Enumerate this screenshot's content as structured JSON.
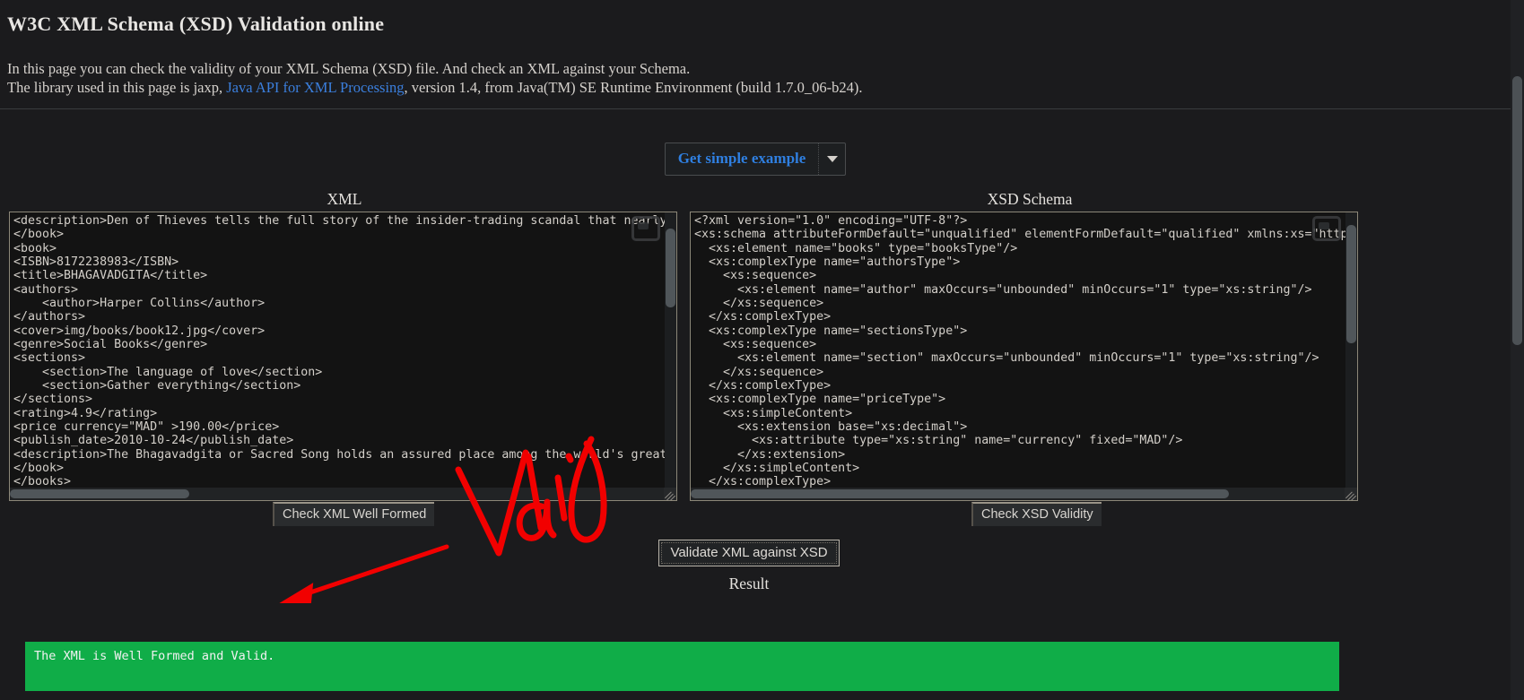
{
  "page": {
    "title": "W3C XML Schema (XSD) Validation online",
    "intro_line1": "In this page you can check the validity of your XML Schema (XSD) file. And check an XML against your Schema.",
    "intro_line2_before": "The library used in this page is jaxp, ",
    "intro_link": "Java API for XML Processing",
    "intro_line2_after": ", version 1.4, from Java(TM) SE Runtime Environment (build 1.7.0_06-b24).",
    "link_color": "#3b7fdd"
  },
  "toolbar": {
    "example_label": "Get simple example",
    "caret_icon": "chevron-down-icon",
    "example_color": "#2f7fe0"
  },
  "panels": {
    "xml_label": "XML",
    "xsd_label": "XSD Schema",
    "xml_content": "<description>Den of Thieves tells the full story of the insider-trading scandal that nearly destroy\n</book>\n<book>\n<ISBN>8172238983</ISBN>\n<title>BHAGAVADGITA</title>\n<authors>\n    <author>Harper Collins</author>\n</authors>\n<cover>img/books/book12.jpg</cover>\n<genre>Social Books</genre>\n<sections>\n    <section>The language of love</section>\n    <section>Gather everything</section>\n</sections>\n<rating>4.9</rating>\n<price currency=\"MAD\" >190.00</price>\n<publish_date>2010-10-24</publish_date>\n<description>The Bhagavadgita or Sacred Song holds an assured place among the world's great script\n</book>\n</books>",
    "xsd_content": "<?xml version=\"1.0\" encoding=\"UTF-8\"?>\n<xs:schema attributeFormDefault=\"unqualified\" elementFormDefault=\"qualified\" xmlns:xs=\"http://www.\n  <xs:element name=\"books\" type=\"booksType\"/>\n  <xs:complexType name=\"authorsType\">\n    <xs:sequence>\n      <xs:element name=\"author\" maxOccurs=\"unbounded\" minOccurs=\"1\" type=\"xs:string\"/>\n    </xs:sequence>\n  </xs:complexType>\n  <xs:complexType name=\"sectionsType\">\n    <xs:sequence>\n      <xs:element name=\"section\" maxOccurs=\"unbounded\" minOccurs=\"1\" type=\"xs:string\"/>\n    </xs:sequence>\n  </xs:complexType>\n  <xs:complexType name=\"priceType\">\n    <xs:simpleContent>\n      <xs:extension base=\"xs:decimal\">\n        <xs:attribute type=\"xs:string\" name=\"currency\" fixed=\"MAD\"/>\n      </xs:extension>\n    </xs:simpleContent>\n  </xs:complexType>"
  },
  "actions": {
    "check_xml_label": "Check XML Well Formed",
    "check_xsd_label": "Check XSD Validity",
    "validate_label": "Validate XML against XSD"
  },
  "result": {
    "label": "Result",
    "text": "The XML is Well Formed and Valid.",
    "background_color": "#10ad48"
  },
  "annotations": {
    "handwriting": "Valid",
    "color": "#f20000"
  }
}
